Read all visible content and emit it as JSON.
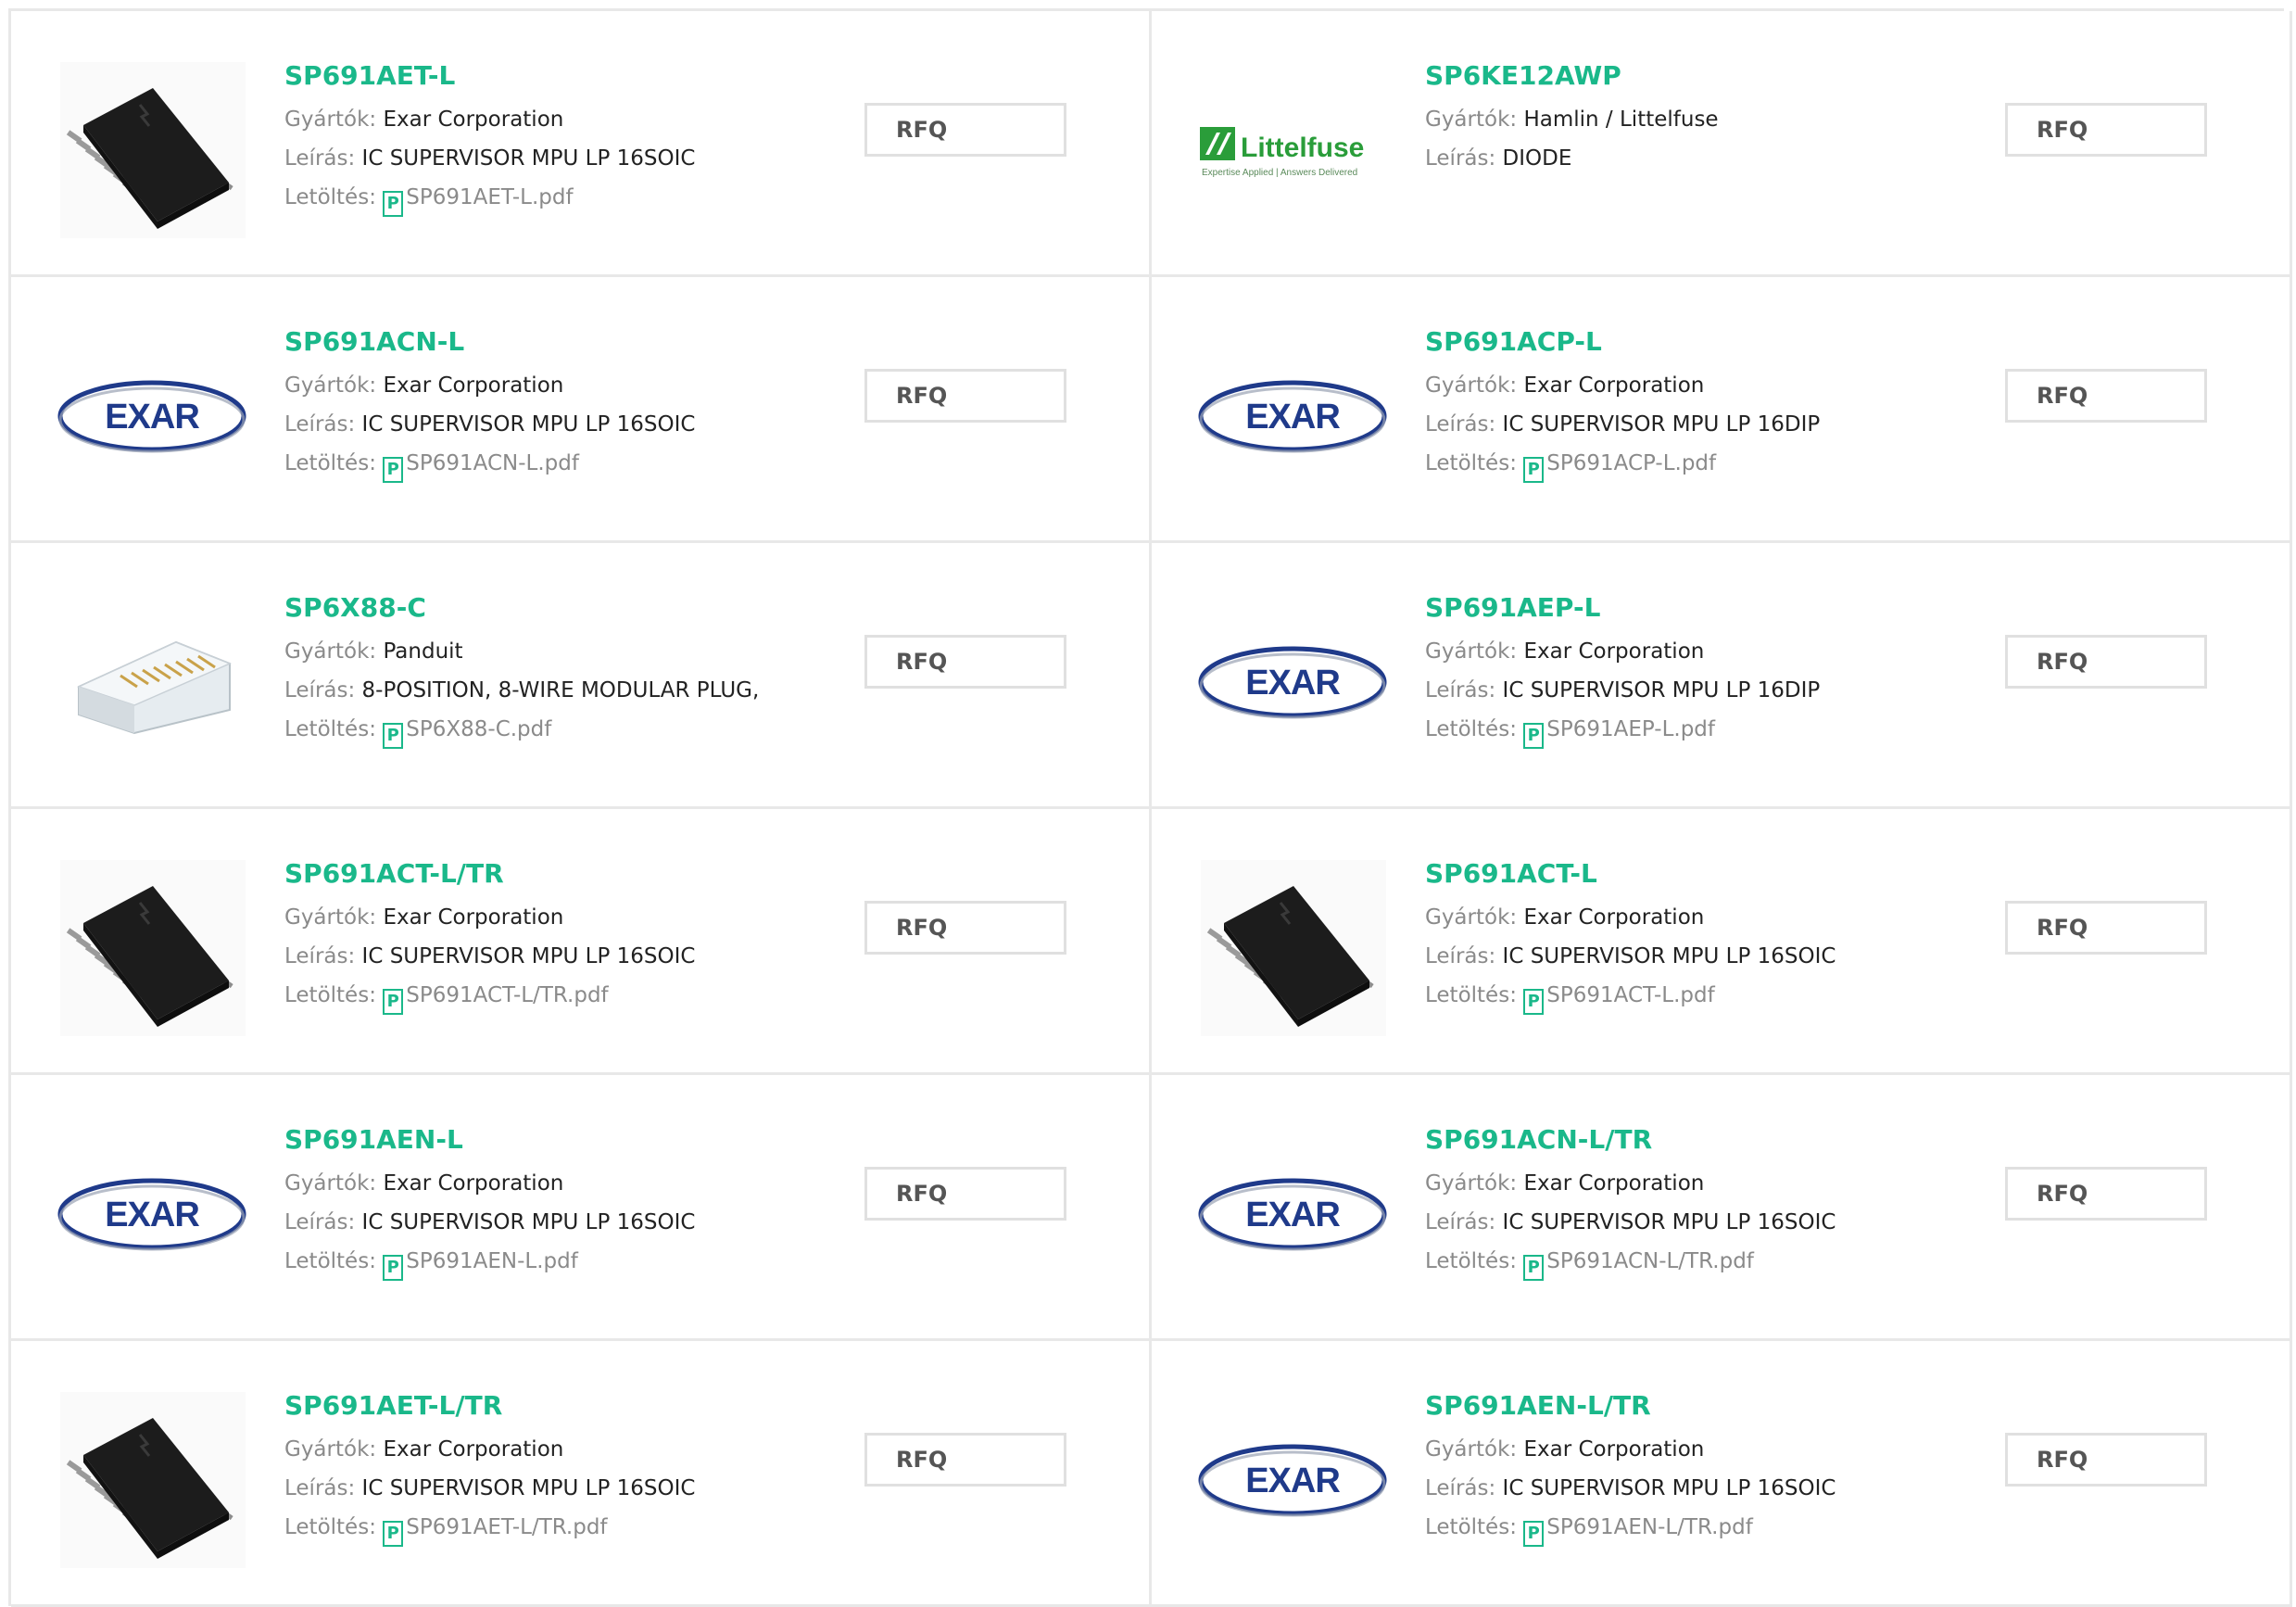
{
  "labels": {
    "manufacturer": "Gyártók:",
    "description": "Leírás:",
    "download": "Letöltés:",
    "rfq": "RFQ",
    "pdf_icon": "P"
  },
  "products": [
    {
      "part": "SP691AET-L",
      "manufacturer": "Exar Corporation",
      "description": "IC SUPERVISOR MPU LP 16SOIC",
      "pdf": "SP691AET-L.pdf",
      "image": "soic-chip"
    },
    {
      "part": "SP6KE12AWP",
      "manufacturer": "Hamlin / Littelfuse",
      "description": "DIODE",
      "pdf": null,
      "image": "littelfuse-logo",
      "logo_text": "Littelfuse",
      "logo_tagline": "Expertise Applied | Answers Delivered"
    },
    {
      "part": "SP691ACN-L",
      "manufacturer": "Exar Corporation",
      "description": "IC SUPERVISOR MPU LP 16SOIC",
      "pdf": "SP691ACN-L.pdf",
      "image": "exar-logo",
      "logo_text": "EXAR"
    },
    {
      "part": "SP691ACP-L",
      "manufacturer": "Exar Corporation",
      "description": "IC SUPERVISOR MPU LP 16DIP",
      "pdf": "SP691ACP-L.pdf",
      "image": "exar-logo",
      "logo_text": "EXAR"
    },
    {
      "part": "SP6X88-C",
      "manufacturer": "Panduit",
      "description": "8-POSITION, 8-WIRE MODULAR PLUG,",
      "pdf": "SP6X88-C.pdf",
      "image": "modular-plug"
    },
    {
      "part": "SP691AEP-L",
      "manufacturer": "Exar Corporation",
      "description": "IC SUPERVISOR MPU LP 16DIP",
      "pdf": "SP691AEP-L.pdf",
      "image": "exar-logo",
      "logo_text": "EXAR"
    },
    {
      "part": "SP691ACT-L/TR",
      "manufacturer": "Exar Corporation",
      "description": "IC SUPERVISOR MPU LP 16SOIC",
      "pdf": "SP691ACT-L/TR.pdf",
      "image": "soic-chip"
    },
    {
      "part": "SP691ACT-L",
      "manufacturer": "Exar Corporation",
      "description": "IC SUPERVISOR MPU LP 16SOIC",
      "pdf": "SP691ACT-L.pdf",
      "image": "soic-chip"
    },
    {
      "part": "SP691AEN-L",
      "manufacturer": "Exar Corporation",
      "description": "IC SUPERVISOR MPU LP 16SOIC",
      "pdf": "SP691AEN-L.pdf",
      "image": "exar-logo",
      "logo_text": "EXAR"
    },
    {
      "part": "SP691ACN-L/TR",
      "manufacturer": "Exar Corporation",
      "description": "IC SUPERVISOR MPU LP 16SOIC",
      "pdf": "SP691ACN-L/TR.pdf",
      "image": "exar-logo",
      "logo_text": "EXAR"
    },
    {
      "part": "SP691AET-L/TR",
      "manufacturer": "Exar Corporation",
      "description": "IC SUPERVISOR MPU LP 16SOIC",
      "pdf": "SP691AET-L/TR.pdf",
      "image": "soic-chip"
    },
    {
      "part": "SP691AEN-L/TR",
      "manufacturer": "Exar Corporation",
      "description": "IC SUPERVISOR MPU LP 16SOIC",
      "pdf": "SP691AEN-L/TR.pdf",
      "image": "exar-logo",
      "logo_text": "EXAR"
    }
  ],
  "colors": {
    "accent": "#1ab88a",
    "label": "#8a8a8a",
    "border": "#e8e8e8",
    "exar_blue": "#1f3a8a"
  }
}
